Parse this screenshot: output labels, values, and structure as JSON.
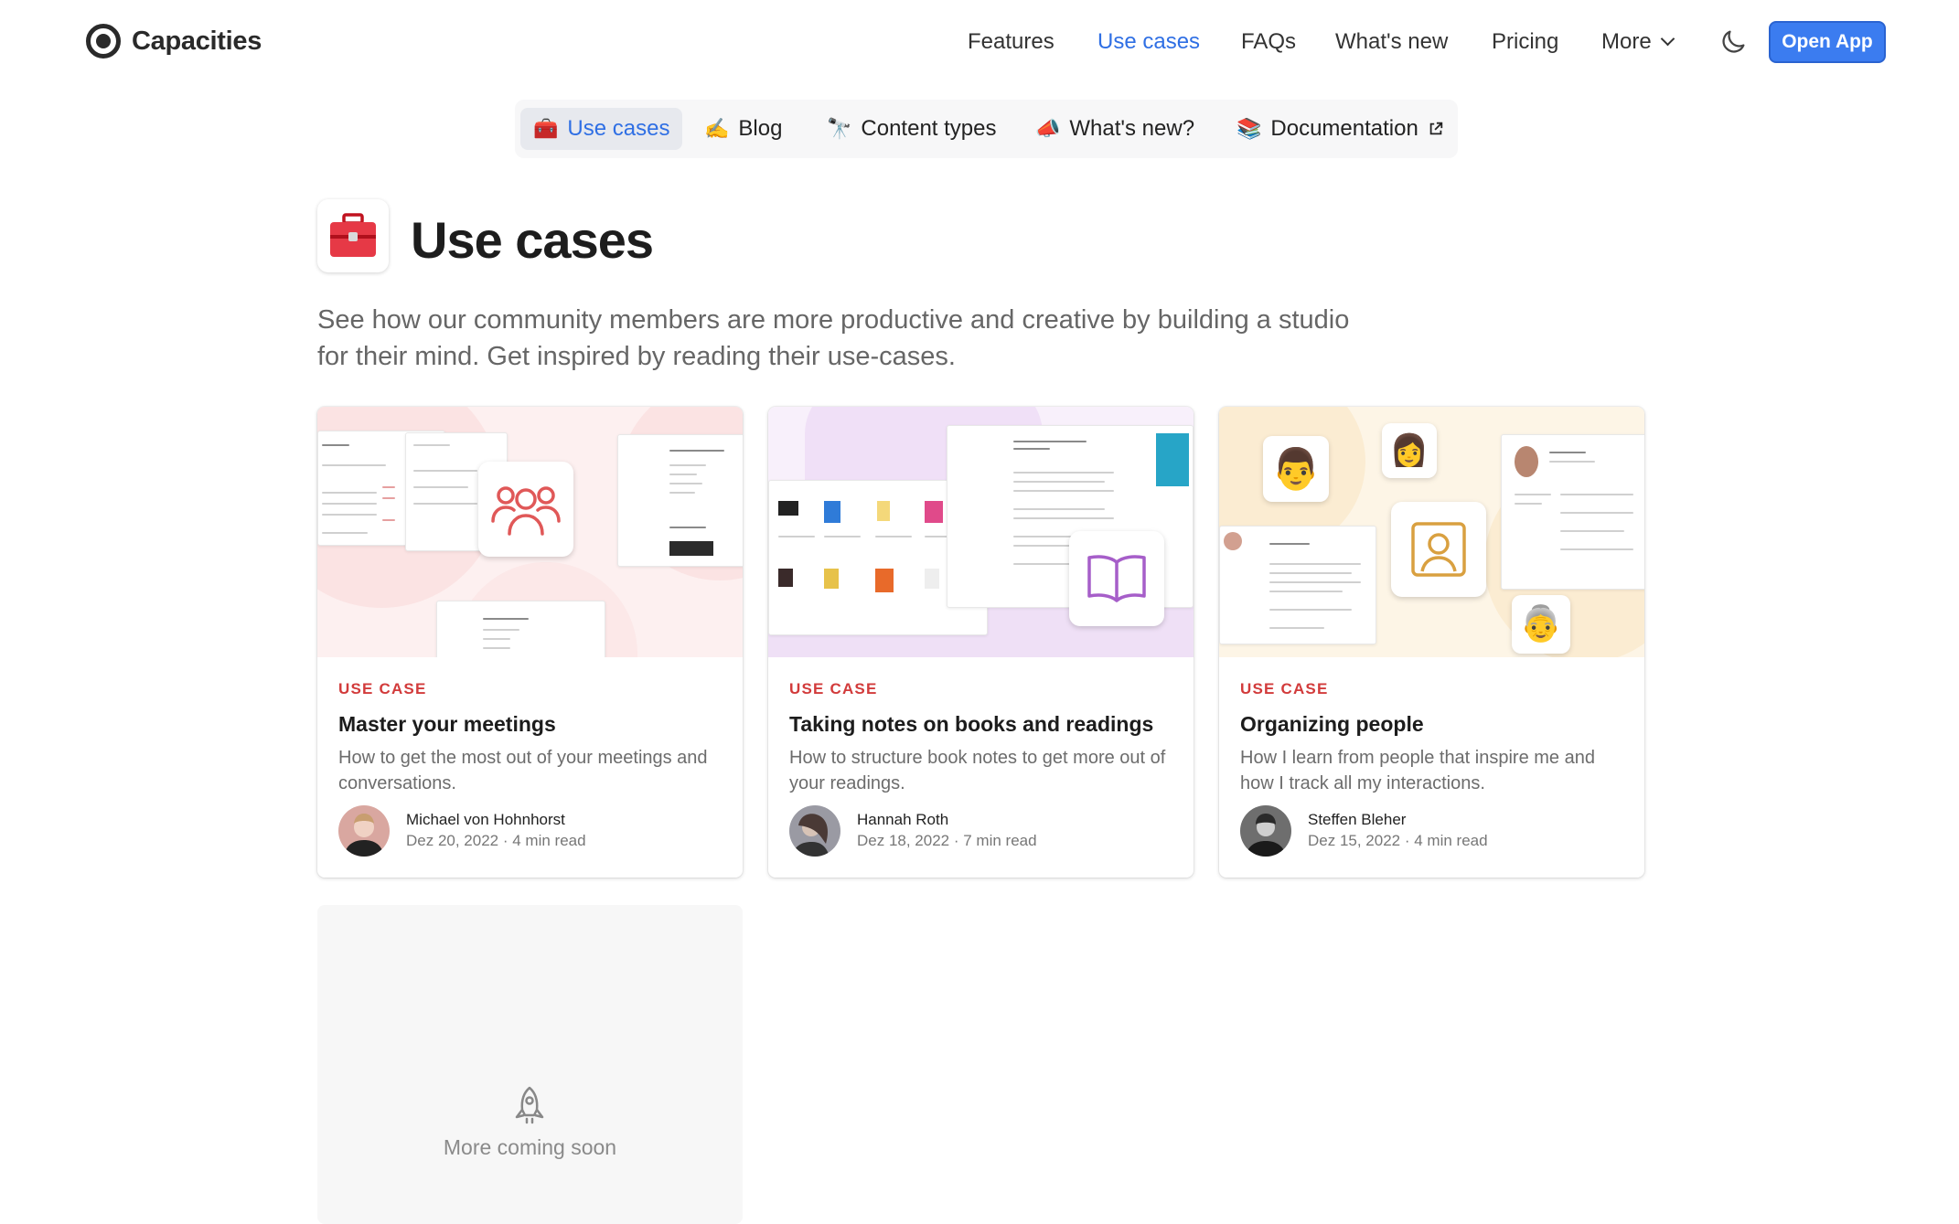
{
  "brand": {
    "name": "Capacities"
  },
  "nav": {
    "links": [
      "Features",
      "Use cases",
      "FAQs",
      "What's new",
      "Pricing",
      "More"
    ],
    "active": "Use cases",
    "cta": "Open App"
  },
  "subnav": {
    "items": [
      {
        "emoji": "🧰",
        "label": "Use cases"
      },
      {
        "emoji": "✍️",
        "label": "Blog"
      },
      {
        "emoji": "🔭",
        "label": "Content types"
      },
      {
        "emoji": "📣",
        "label": "What's new?"
      },
      {
        "emoji": "📚",
        "label": "Documentation"
      }
    ],
    "active": "Use cases"
  },
  "page": {
    "title": "Use cases",
    "description": "See how our community members are more productive and creative by building a studio for their mind. Get inspired by reading their use-cases."
  },
  "cards": [
    {
      "kicker": "USE CASE",
      "title": "Master your meetings",
      "description": "How to get the most out of your meetings and conversations.",
      "author": "Michael von Hohnhorst",
      "date": "Dez 20, 2022",
      "read_time": "4 min read",
      "accent": "#e05858"
    },
    {
      "kicker": "USE CASE",
      "title": "Taking notes on books and readings",
      "description": "How to structure book notes to get more out of your readings.",
      "author": "Hannah Roth",
      "date": "Dez 18, 2022",
      "read_time": "7 min read",
      "accent": "#a65ec9"
    },
    {
      "kicker": "USE CASE",
      "title": "Organizing people",
      "description": "How I learn from people that inspire me and how I track all my interactions.",
      "author": "Steffen Bleher",
      "date": "Dez 15, 2022",
      "read_time": "4 min read",
      "accent": "#d9a040"
    }
  ],
  "coming_soon": {
    "label": "More coming soon",
    "icon": "rocket-icon"
  },
  "colors": {
    "link_active": "#2f6fe4",
    "cta": "#3b7cf0",
    "kicker": "#d23b3b"
  }
}
